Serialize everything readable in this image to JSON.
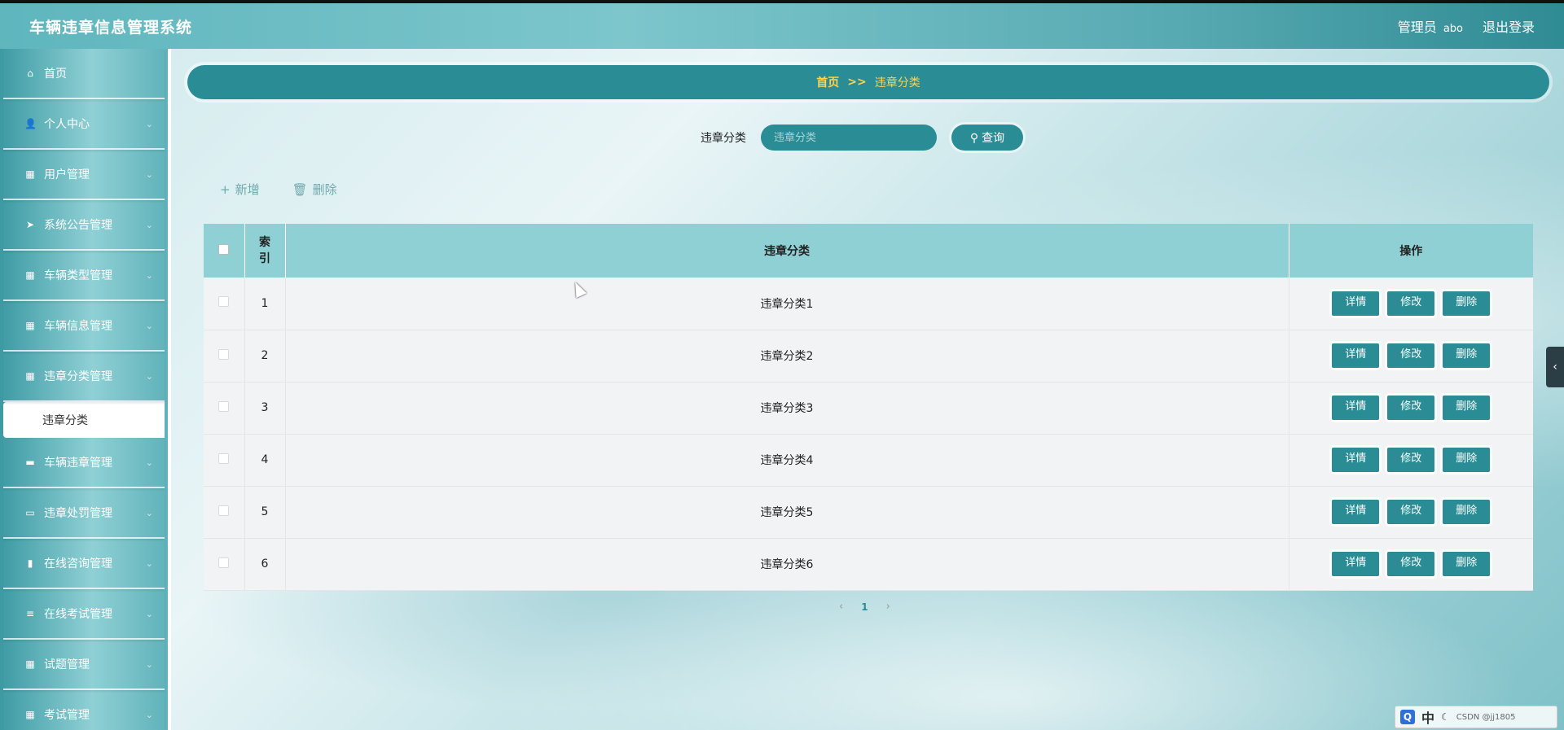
{
  "header": {
    "title": "车辆违章信息管理系统",
    "user_role": "管理员",
    "user_name": "abo",
    "logout": "退出登录"
  },
  "sidebar": {
    "items": [
      {
        "label": "首页",
        "icon": "home-icon",
        "glyph": "⌂"
      },
      {
        "label": "个人中心",
        "icon": "user-icon",
        "glyph": "👤"
      },
      {
        "label": "用户管理",
        "icon": "grid-icon",
        "glyph": "▦"
      },
      {
        "label": "系统公告管理",
        "icon": "send-icon",
        "glyph": "➤"
      },
      {
        "label": "车辆类型管理",
        "icon": "grid-icon",
        "glyph": "▦"
      },
      {
        "label": "车辆信息管理",
        "icon": "grid-icon",
        "glyph": "▦"
      },
      {
        "label": "违章分类管理",
        "icon": "grid-icon",
        "glyph": "▦"
      }
    ],
    "active_sub": "违章分类",
    "items_after": [
      {
        "label": "车辆违章管理",
        "icon": "briefcase-icon",
        "glyph": "▬"
      },
      {
        "label": "违章处罚管理",
        "icon": "monitor-icon",
        "glyph": "▭"
      },
      {
        "label": "在线咨询管理",
        "icon": "bar-chart-icon",
        "glyph": "▮"
      },
      {
        "label": "在线考试管理",
        "icon": "list-icon",
        "glyph": "≡"
      },
      {
        "label": "试题管理",
        "icon": "grid-icon",
        "glyph": "▦"
      },
      {
        "label": "考试管理",
        "icon": "grid-icon",
        "glyph": "▦"
      }
    ]
  },
  "breadcrumb": {
    "home": "首页",
    "separator": ">>",
    "current": "违章分类"
  },
  "search": {
    "label": "违章分类",
    "placeholder": "违章分类",
    "button": "查询"
  },
  "actions": {
    "add": "新增",
    "delete": "删除"
  },
  "table": {
    "headers": {
      "index": "索引",
      "category": "违章分类",
      "operation": "操作"
    },
    "rows": [
      {
        "index": "1",
        "category": "违章分类1"
      },
      {
        "index": "2",
        "category": "违章分类2"
      },
      {
        "index": "3",
        "category": "违章分类3"
      },
      {
        "index": "4",
        "category": "违章分类4"
      },
      {
        "index": "5",
        "category": "违章分类5"
      },
      {
        "index": "6",
        "category": "违章分类6"
      }
    ],
    "row_buttons": {
      "detail": "详情",
      "edit": "修改",
      "delete": "删除"
    }
  },
  "pagination": {
    "prev": "‹",
    "current": "1",
    "next": "›"
  },
  "tray": {
    "q": "Q",
    "lang": "中",
    "moon": "☾",
    "text": "CSDN @jj1805"
  },
  "colors": {
    "primary": "#2a8d95",
    "breadcrumb_text": "#ffd24d",
    "table_header": "#8fd0d5"
  }
}
